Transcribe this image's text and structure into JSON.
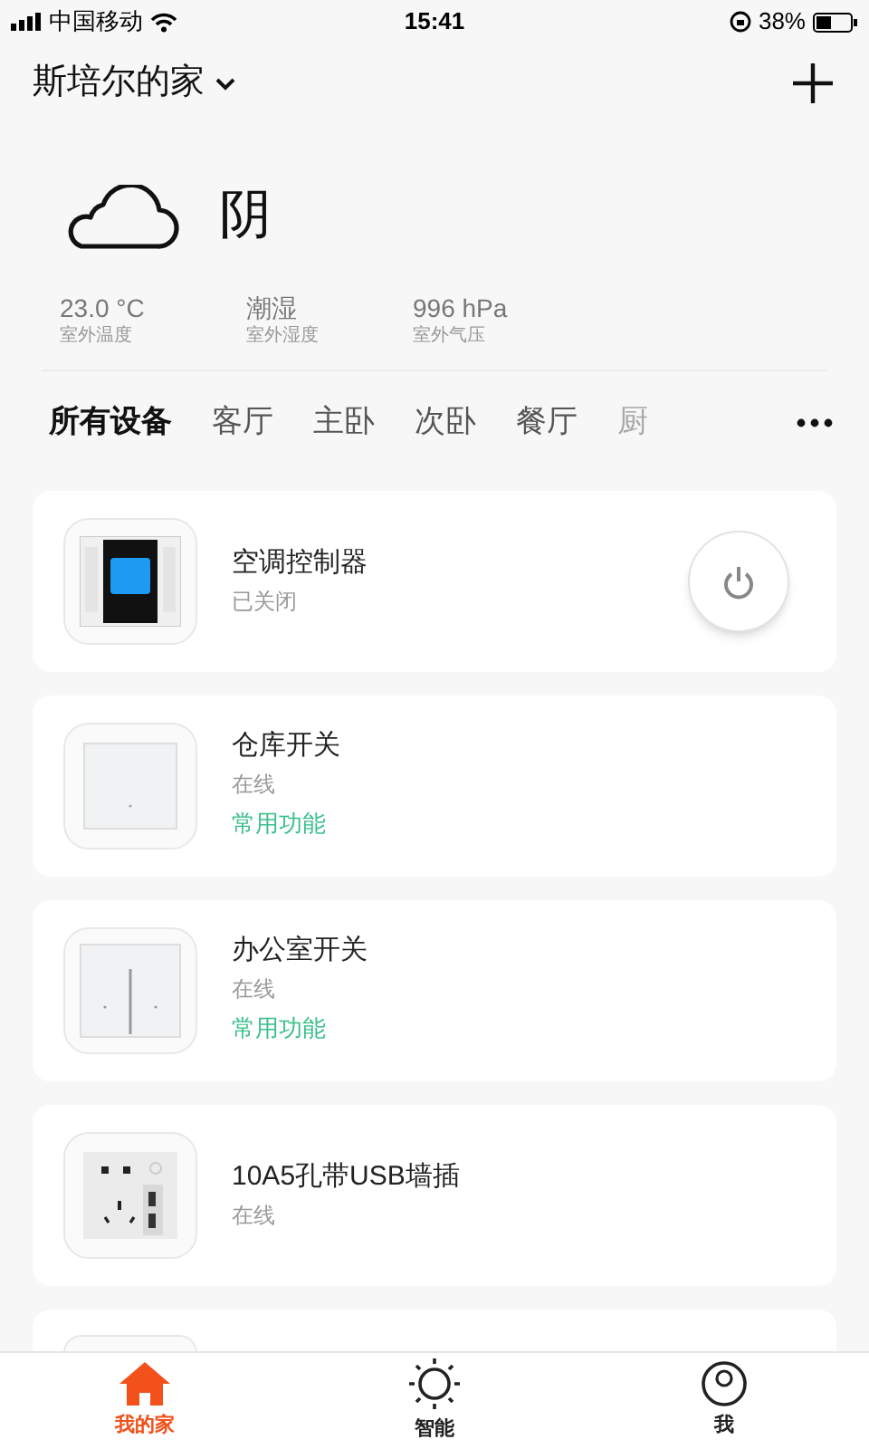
{
  "status_bar": {
    "carrier": "中国移动",
    "time": "15:41",
    "battery": "38%"
  },
  "header": {
    "home_name": "斯培尔的家"
  },
  "weather": {
    "condition": "阴",
    "stats": [
      {
        "value": "23.0 °C",
        "label": "室外温度"
      },
      {
        "value": "潮湿",
        "label": "室外湿度"
      },
      {
        "value": "996 hPa",
        "label": "室外气压"
      }
    ]
  },
  "rooms": [
    {
      "label": "所有设备",
      "selected": true
    },
    {
      "label": "客厅",
      "selected": false
    },
    {
      "label": "主卧",
      "selected": false
    },
    {
      "label": "次卧",
      "selected": false
    },
    {
      "label": "餐厅",
      "selected": false
    },
    {
      "label": "厨",
      "selected": false,
      "faded": true
    }
  ],
  "devices": [
    {
      "kind": "ac-panel",
      "name": "空调控制器",
      "status": "已关闭",
      "power_button": true
    },
    {
      "kind": "switch-1",
      "name": "仓库开关",
      "status": "在线",
      "shortcut": "常用功能"
    },
    {
      "kind": "switch-2",
      "name": "办公室开关",
      "status": "在线",
      "shortcut": "常用功能"
    },
    {
      "kind": "socket",
      "name": "10A5孔带USB墙插",
      "status": "在线"
    },
    {
      "kind": "partial"
    }
  ],
  "bottom_nav": [
    {
      "label": "我的家",
      "kind": "home",
      "selected": true
    },
    {
      "label": "智能",
      "kind": "sun",
      "selected": false
    },
    {
      "label": "我",
      "kind": "person",
      "selected": false
    }
  ]
}
